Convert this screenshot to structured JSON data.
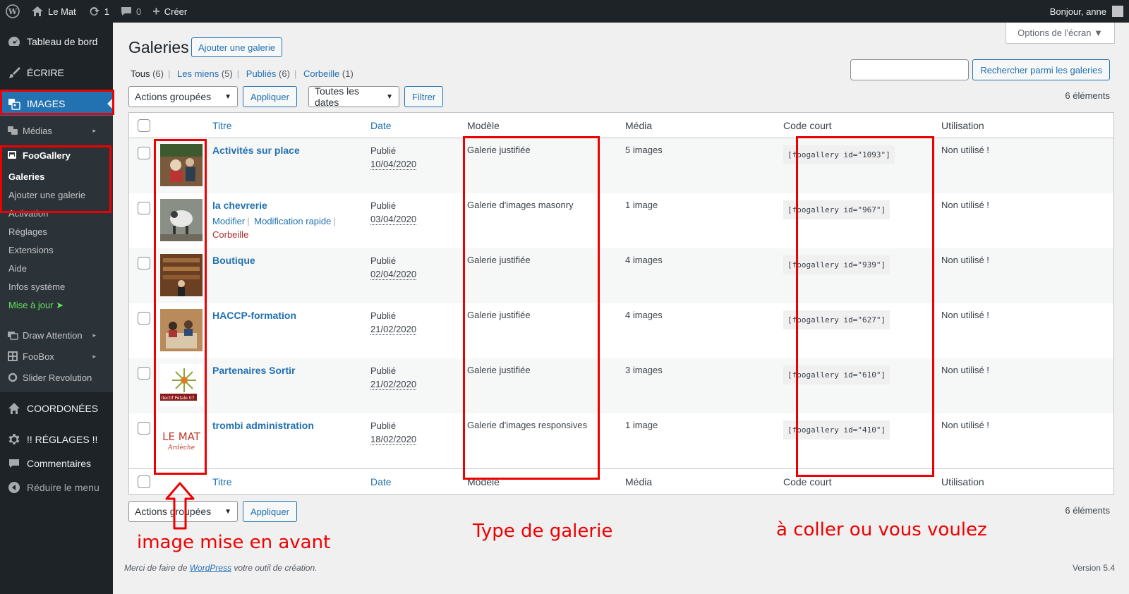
{
  "adminbar": {
    "site_name": "Le Mat",
    "updates_count": "1",
    "comments_count": "0",
    "new_label": "Créer",
    "greeting": "Bonjour, anne"
  },
  "sidebar": {
    "dashboard": "Tableau de bord",
    "write": "ÉCRIRE",
    "images": "IMAGES",
    "media": "Médias",
    "foogallery": "FooGallery",
    "foo_items": [
      "Galeries",
      "Ajouter une galerie",
      "Activation",
      "Réglages",
      "Extensions",
      "Aide",
      "Infos système"
    ],
    "update": "Mise à jour ➤",
    "draw_attention": "Draw Attention",
    "foobox": "FooBox",
    "slider": "Slider Revolution",
    "coordonnees": "COORDONÉES",
    "reglages": "!! RÉGLAGES !!",
    "comments": "Commentaires",
    "collapse": "Réduire le menu"
  },
  "page": {
    "screen_options": "Options de l'écran ▼",
    "title": "Galeries",
    "add_button": "Ajouter une galerie",
    "views": {
      "all": "Tous",
      "all_count": "(6)",
      "mine": "Les miens",
      "mine_count": "(5)",
      "published": "Publiés",
      "published_count": "(6)",
      "trash": "Corbeille",
      "trash_count": "(1)"
    },
    "search_button": "Rechercher parmi les galeries",
    "bulk_actions": "Actions groupées",
    "apply": "Appliquer",
    "all_dates": "Toutes les dates",
    "filter": "Filtrer",
    "items_count": "6 éléments"
  },
  "table": {
    "headers": {
      "title": "Titre",
      "date": "Date",
      "model": "Modèle",
      "media": "Média",
      "code": "Code court",
      "usage": "Utilisation"
    },
    "row_actions": {
      "edit": "Modifier",
      "quick_edit": "Modification rapide",
      "trash": "Corbeille"
    },
    "rows": [
      {
        "title": "Activités sur place",
        "status": "Publié",
        "date": "10/04/2020",
        "model": "Galerie justifiée",
        "media": "5 images",
        "code": "[foogallery id=\"1093\"]",
        "usage": "Non utilisé !"
      },
      {
        "title": "la chevrerie",
        "status": "Publié",
        "date": "03/04/2020",
        "model": "Galerie d'images masonry",
        "media": "1 image",
        "code": "[foogallery id=\"967\"]",
        "usage": "Non utilisé !"
      },
      {
        "title": "Boutique",
        "status": "Publié",
        "date": "02/04/2020",
        "model": "Galerie justifiée",
        "media": "4 images",
        "code": "[foogallery id=\"939\"]",
        "usage": "Non utilisé !"
      },
      {
        "title": "HACCP-formation",
        "status": "Publié",
        "date": "21/02/2020",
        "model": "Galerie justifiée",
        "media": "4 images",
        "code": "[foogallery id=\"627\"]",
        "usage": "Non utilisé !"
      },
      {
        "title": "Partenaires Sortir",
        "status": "Publié",
        "date": "21/02/2020",
        "model": "Galerie justifiée",
        "media": "3 images",
        "code": "[foogallery id=\"610\"]",
        "usage": "Non utilisé !"
      },
      {
        "title": "trombi administration",
        "status": "Publié",
        "date": "18/02/2020",
        "model": "Galerie d'images responsives",
        "media": "1 image",
        "code": "[foogallery id=\"410\"]",
        "usage": "Non utilisé !"
      }
    ]
  },
  "thumbs": {
    "partenaires_text": "llectif Pétale 07",
    "lemat_line1": "LE MAT",
    "lemat_line2": "Ardèche"
  },
  "footer": {
    "thanks_prefix": "Merci de faire de ",
    "wordpress": "WordPress",
    "thanks_suffix": " votre outil de création.",
    "version": "Version 5.4"
  },
  "annotations": {
    "featured_image": "image mise en avant",
    "gallery_type": "Type de galerie",
    "paste": "à coller ou vous voulez"
  },
  "colors": {
    "accent": "#2271b1",
    "annotation": "#ee0000",
    "sidebar": "#1d2327"
  }
}
